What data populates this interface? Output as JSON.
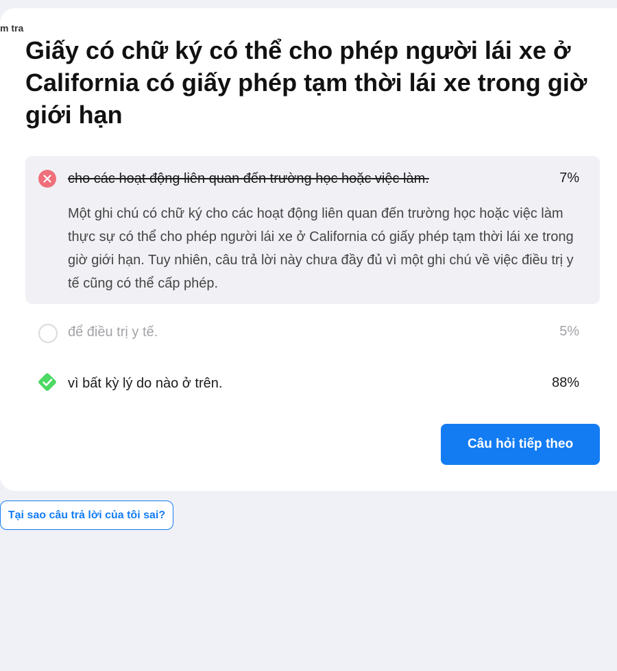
{
  "breadcrumb": "m tra",
  "question": "Giấy có chữ ký có thể cho phép người lái xe ở California có giấy phép tạm thời lái xe trong giờ giới hạn",
  "answers": [
    {
      "text": "cho các hoạt động liên quan đến trường học hoặc việc làm.",
      "percent": "7%",
      "state": "incorrect-selected",
      "icon": "x-circle-icon",
      "explanation": "Một ghi chú có chữ ký cho các hoạt động liên quan đến trường học hoặc việc làm thực sự có thể cho phép người lái xe ở California có giấy phép tạm thời lái xe trong giờ giới hạn. Tuy nhiên, câu trả lời này chưa đầy đủ vì một ghi chú về việc điều trị y tế cũng có thể cấp phép."
    },
    {
      "text": "để điều trị y tế.",
      "percent": "5%",
      "state": "unselected",
      "icon": "empty-circle-icon"
    },
    {
      "text": "vì bất kỳ lý do nào ở trên.",
      "percent": "88%",
      "state": "correct",
      "icon": "check-diamond-icon"
    }
  ],
  "next_button": "Câu hỏi tiếp theo",
  "why_button": "Tại sao câu trả lời của tôi sai?",
  "colors": {
    "accent": "#137cf2",
    "incorrect": "#ef6f7b",
    "correct": "#4cd964",
    "background": "#f0f1f6"
  }
}
